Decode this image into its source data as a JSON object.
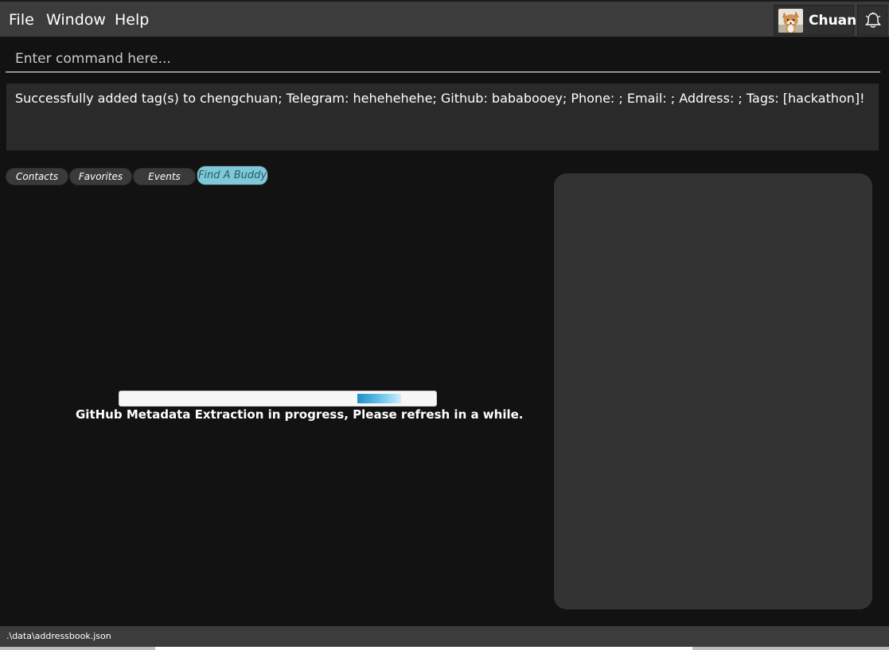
{
  "menu": {
    "file": "File",
    "window": "Window",
    "help": "Help"
  },
  "user": {
    "name": "Chuan",
    "avatar_icon": "dog-avatar",
    "notification_icon": "bell-icon"
  },
  "command": {
    "placeholder": "Enter command here...",
    "value": ""
  },
  "result": {
    "message": "Successfully added tag(s) to chengchuan; Telegram: hehehehehe; Github: bababooey; Phone: ; Email: ; Address: ; Tags: [hackathon]!"
  },
  "tabs": [
    {
      "label": "Contacts",
      "selected": false
    },
    {
      "label": "Favorites",
      "selected": false
    },
    {
      "label": "Events",
      "selected": false
    },
    {
      "label": "Find A Buddy",
      "selected": true
    }
  ],
  "progress": {
    "message": "GitHub Metadata Extraction in progress, Please refresh in a while.",
    "indeterminate_start": 0.75,
    "indeterminate_end": 0.89
  },
  "status": {
    "path": ".\\data\\addressbook.json"
  },
  "colors": {
    "accent": "#7ec8d7",
    "background": "#121212",
    "menubar": "#3c3c3c",
    "progress": "#1e8fc8"
  }
}
